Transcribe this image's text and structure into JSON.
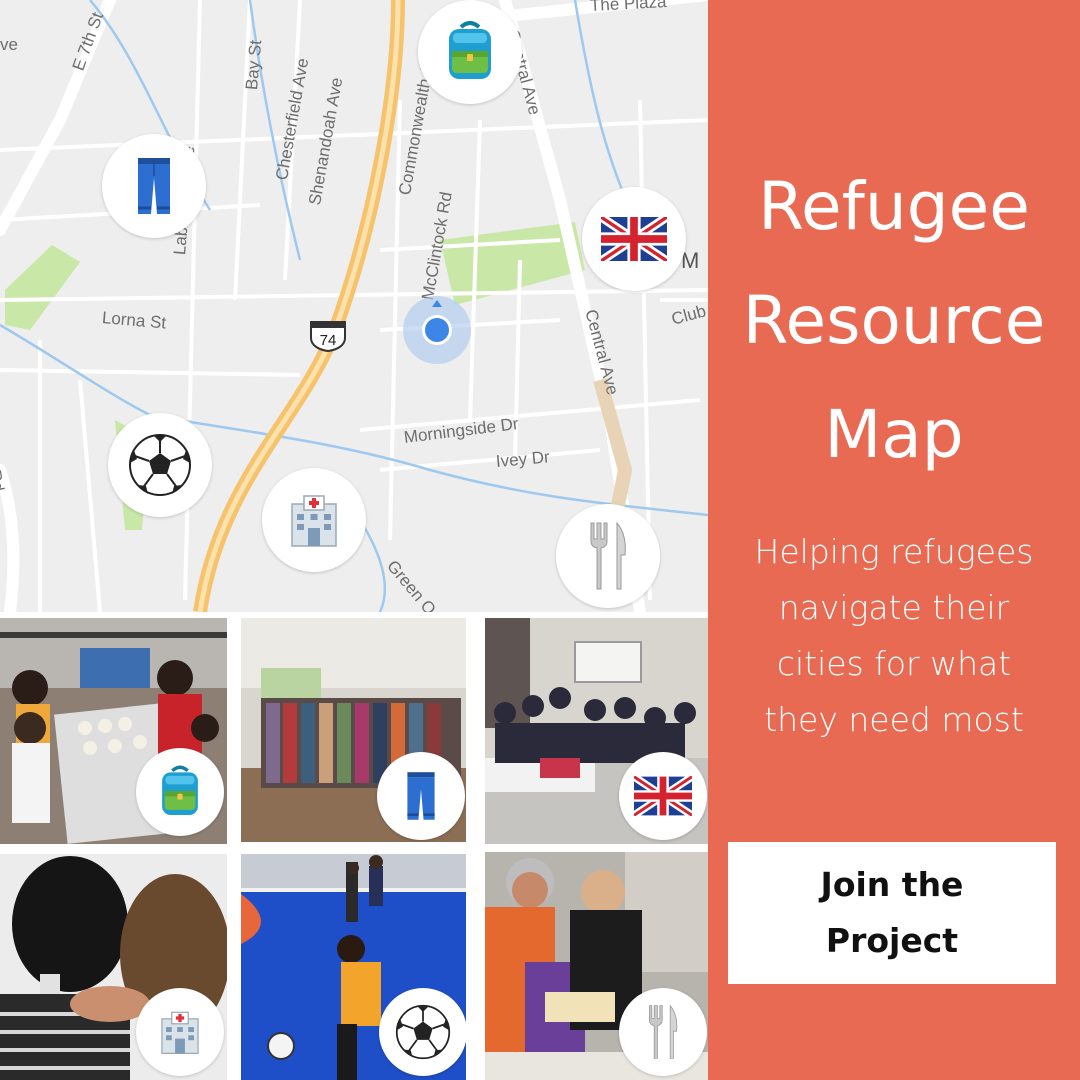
{
  "map": {
    "streets": [
      "E 7th St",
      "Bay St",
      "Chesterfield Ave",
      "Shenandoah Ave",
      "Commonwealth Ave",
      "Central Ave",
      "Central Ave",
      "Laburnum Ave",
      "McClintock Rd",
      "Lorna St",
      "Morningside Dr",
      "Ivey Dr",
      "Green Oak",
      "Club",
      "The Plaza",
      "Rd",
      "ve",
      "M"
    ],
    "route_shield": "74",
    "markers": [
      {
        "icon": "backpack-icon"
      },
      {
        "icon": "jeans-icon"
      },
      {
        "icon": "uk-flag-icon"
      },
      {
        "icon": "soccer-ball-icon"
      },
      {
        "icon": "hospital-icon"
      },
      {
        "icon": "fork-knife-icon"
      }
    ]
  },
  "panel": {
    "title_lines": [
      "Refugee",
      "Resource",
      "Map"
    ],
    "subtitle_lines": [
      "Helping refugees",
      "navigate their",
      "cities for what",
      "they need most"
    ],
    "cta_lines": [
      "Join the",
      "Project"
    ],
    "background": "#e96a52"
  },
  "photos": [
    {
      "marker": "backpack-icon"
    },
    {
      "marker": "jeans-icon"
    },
    {
      "marker": "uk-flag-icon"
    },
    {
      "marker": "hospital-icon"
    },
    {
      "marker": "soccer-ball-icon"
    },
    {
      "marker": "fork-knife-icon"
    }
  ]
}
